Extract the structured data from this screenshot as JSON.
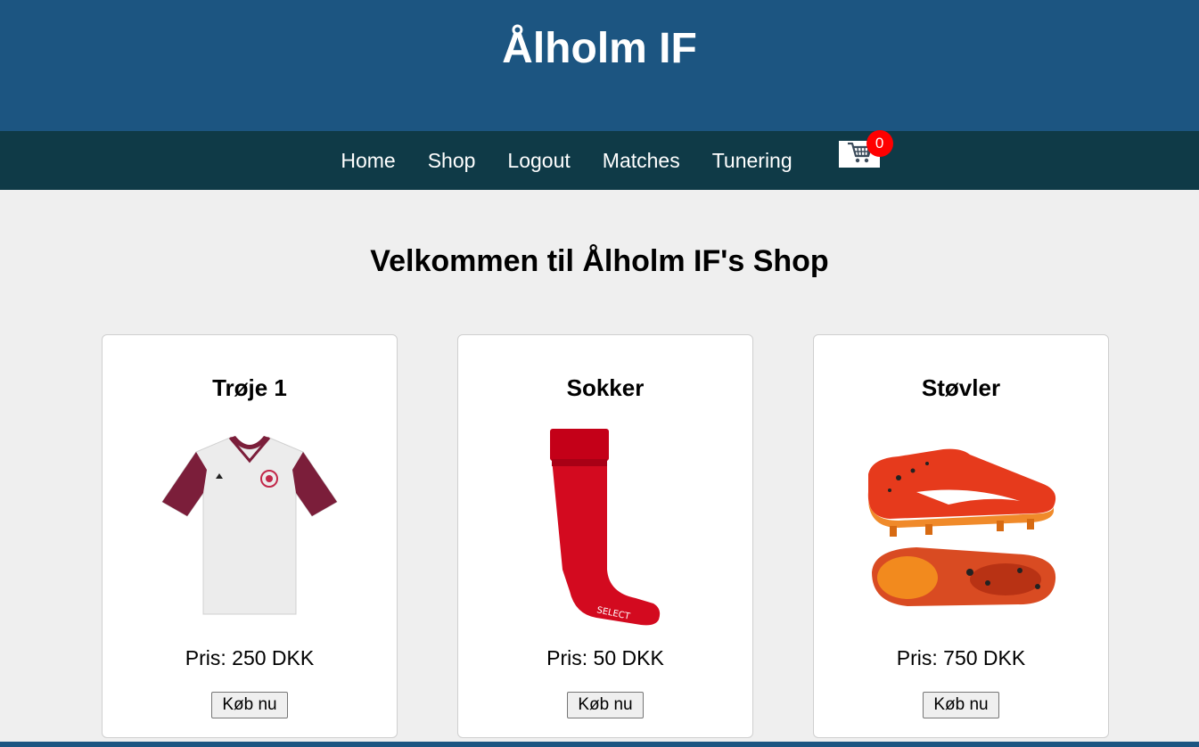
{
  "header": {
    "title": "Ålholm IF"
  },
  "nav": {
    "links": [
      "Home",
      "Shop",
      "Logout",
      "Matches",
      "Tunering"
    ],
    "cart_count": "0"
  },
  "main": {
    "heading": "Velkommen til Ålholm IF's Shop",
    "products": [
      {
        "name": "Trøje 1",
        "price": "Pris: 250 DKK",
        "button": "Køb nu",
        "image": "jersey-image"
      },
      {
        "name": "Sokker",
        "price": "Pris: 50 DKK",
        "button": "Køb nu",
        "image": "sock-image"
      },
      {
        "name": "Støvler",
        "price": "Pris: 750 DKK",
        "button": "Køb nu",
        "image": "boots-image"
      }
    ]
  },
  "colors": {
    "header_bg": "#1c5581",
    "nav_bg": "#0f3a47",
    "badge": "#ff0000"
  }
}
